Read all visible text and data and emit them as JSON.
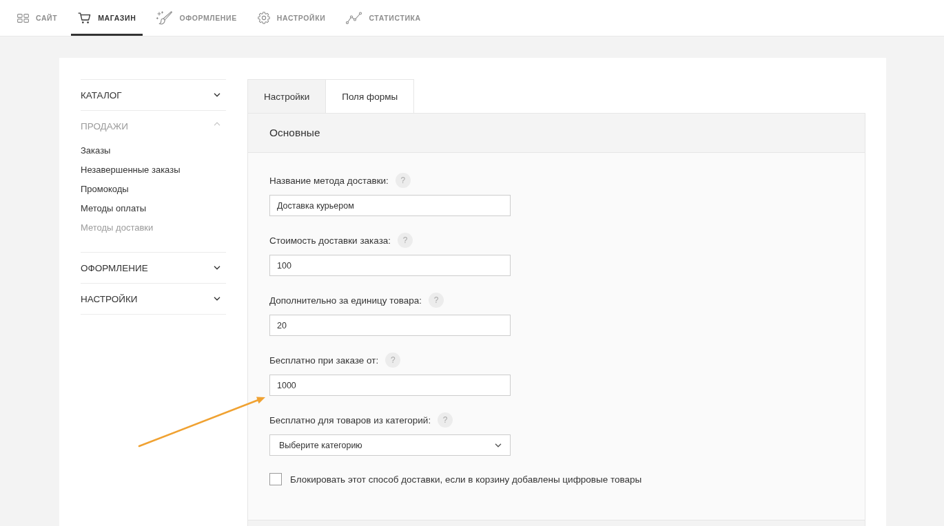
{
  "top_nav": [
    {
      "label": "САЙТ",
      "selected": false
    },
    {
      "label": "МАГАЗИН",
      "selected": true
    },
    {
      "label": "ОФОРМЛЕНИЕ",
      "selected": false
    },
    {
      "label": "НАСТРОЙКИ",
      "selected": false
    },
    {
      "label": "СТАТИСТИКА",
      "selected": false
    }
  ],
  "sidebar": {
    "sections": [
      {
        "title": "КАТАЛОГ",
        "expanded": false
      },
      {
        "title": "ПРОДАЖИ",
        "expanded": true,
        "items": [
          {
            "label": "Заказы",
            "selected": false
          },
          {
            "label": "Незавершенные заказы",
            "selected": false
          },
          {
            "label": "Промокоды",
            "selected": false
          },
          {
            "label": "Методы оплаты",
            "selected": false
          },
          {
            "label": "Методы доставки",
            "selected": true
          }
        ]
      },
      {
        "title": "ОФОРМЛЕНИЕ",
        "expanded": false
      },
      {
        "title": "НАСТРОЙКИ",
        "expanded": false
      }
    ]
  },
  "tabs": [
    {
      "label": "Настройки",
      "selected": true
    },
    {
      "label": "Поля формы",
      "selected": false
    }
  ],
  "panel": {
    "title": "Основные",
    "fields": [
      {
        "kind": "text",
        "label": "Название метода доставки:",
        "help": "?",
        "value": "Доставка курьером"
      },
      {
        "kind": "text",
        "label": "Стоимость доставки заказа:",
        "help": "?",
        "value": "100"
      },
      {
        "kind": "text",
        "label": "Дополнительно за единицу товара:",
        "help": "?",
        "value": "20"
      },
      {
        "kind": "text",
        "label": "Бесплатно при заказе от:",
        "help": "?",
        "value": "1000"
      },
      {
        "kind": "select",
        "label": "Бесплатно для товаров из категорий:",
        "help": "?",
        "value": "Выберите категорию"
      },
      {
        "kind": "checkbox",
        "label": "Блокировать этот способ доставки, если в корзину добавлены цифровые товары",
        "checked": false
      }
    ]
  }
}
